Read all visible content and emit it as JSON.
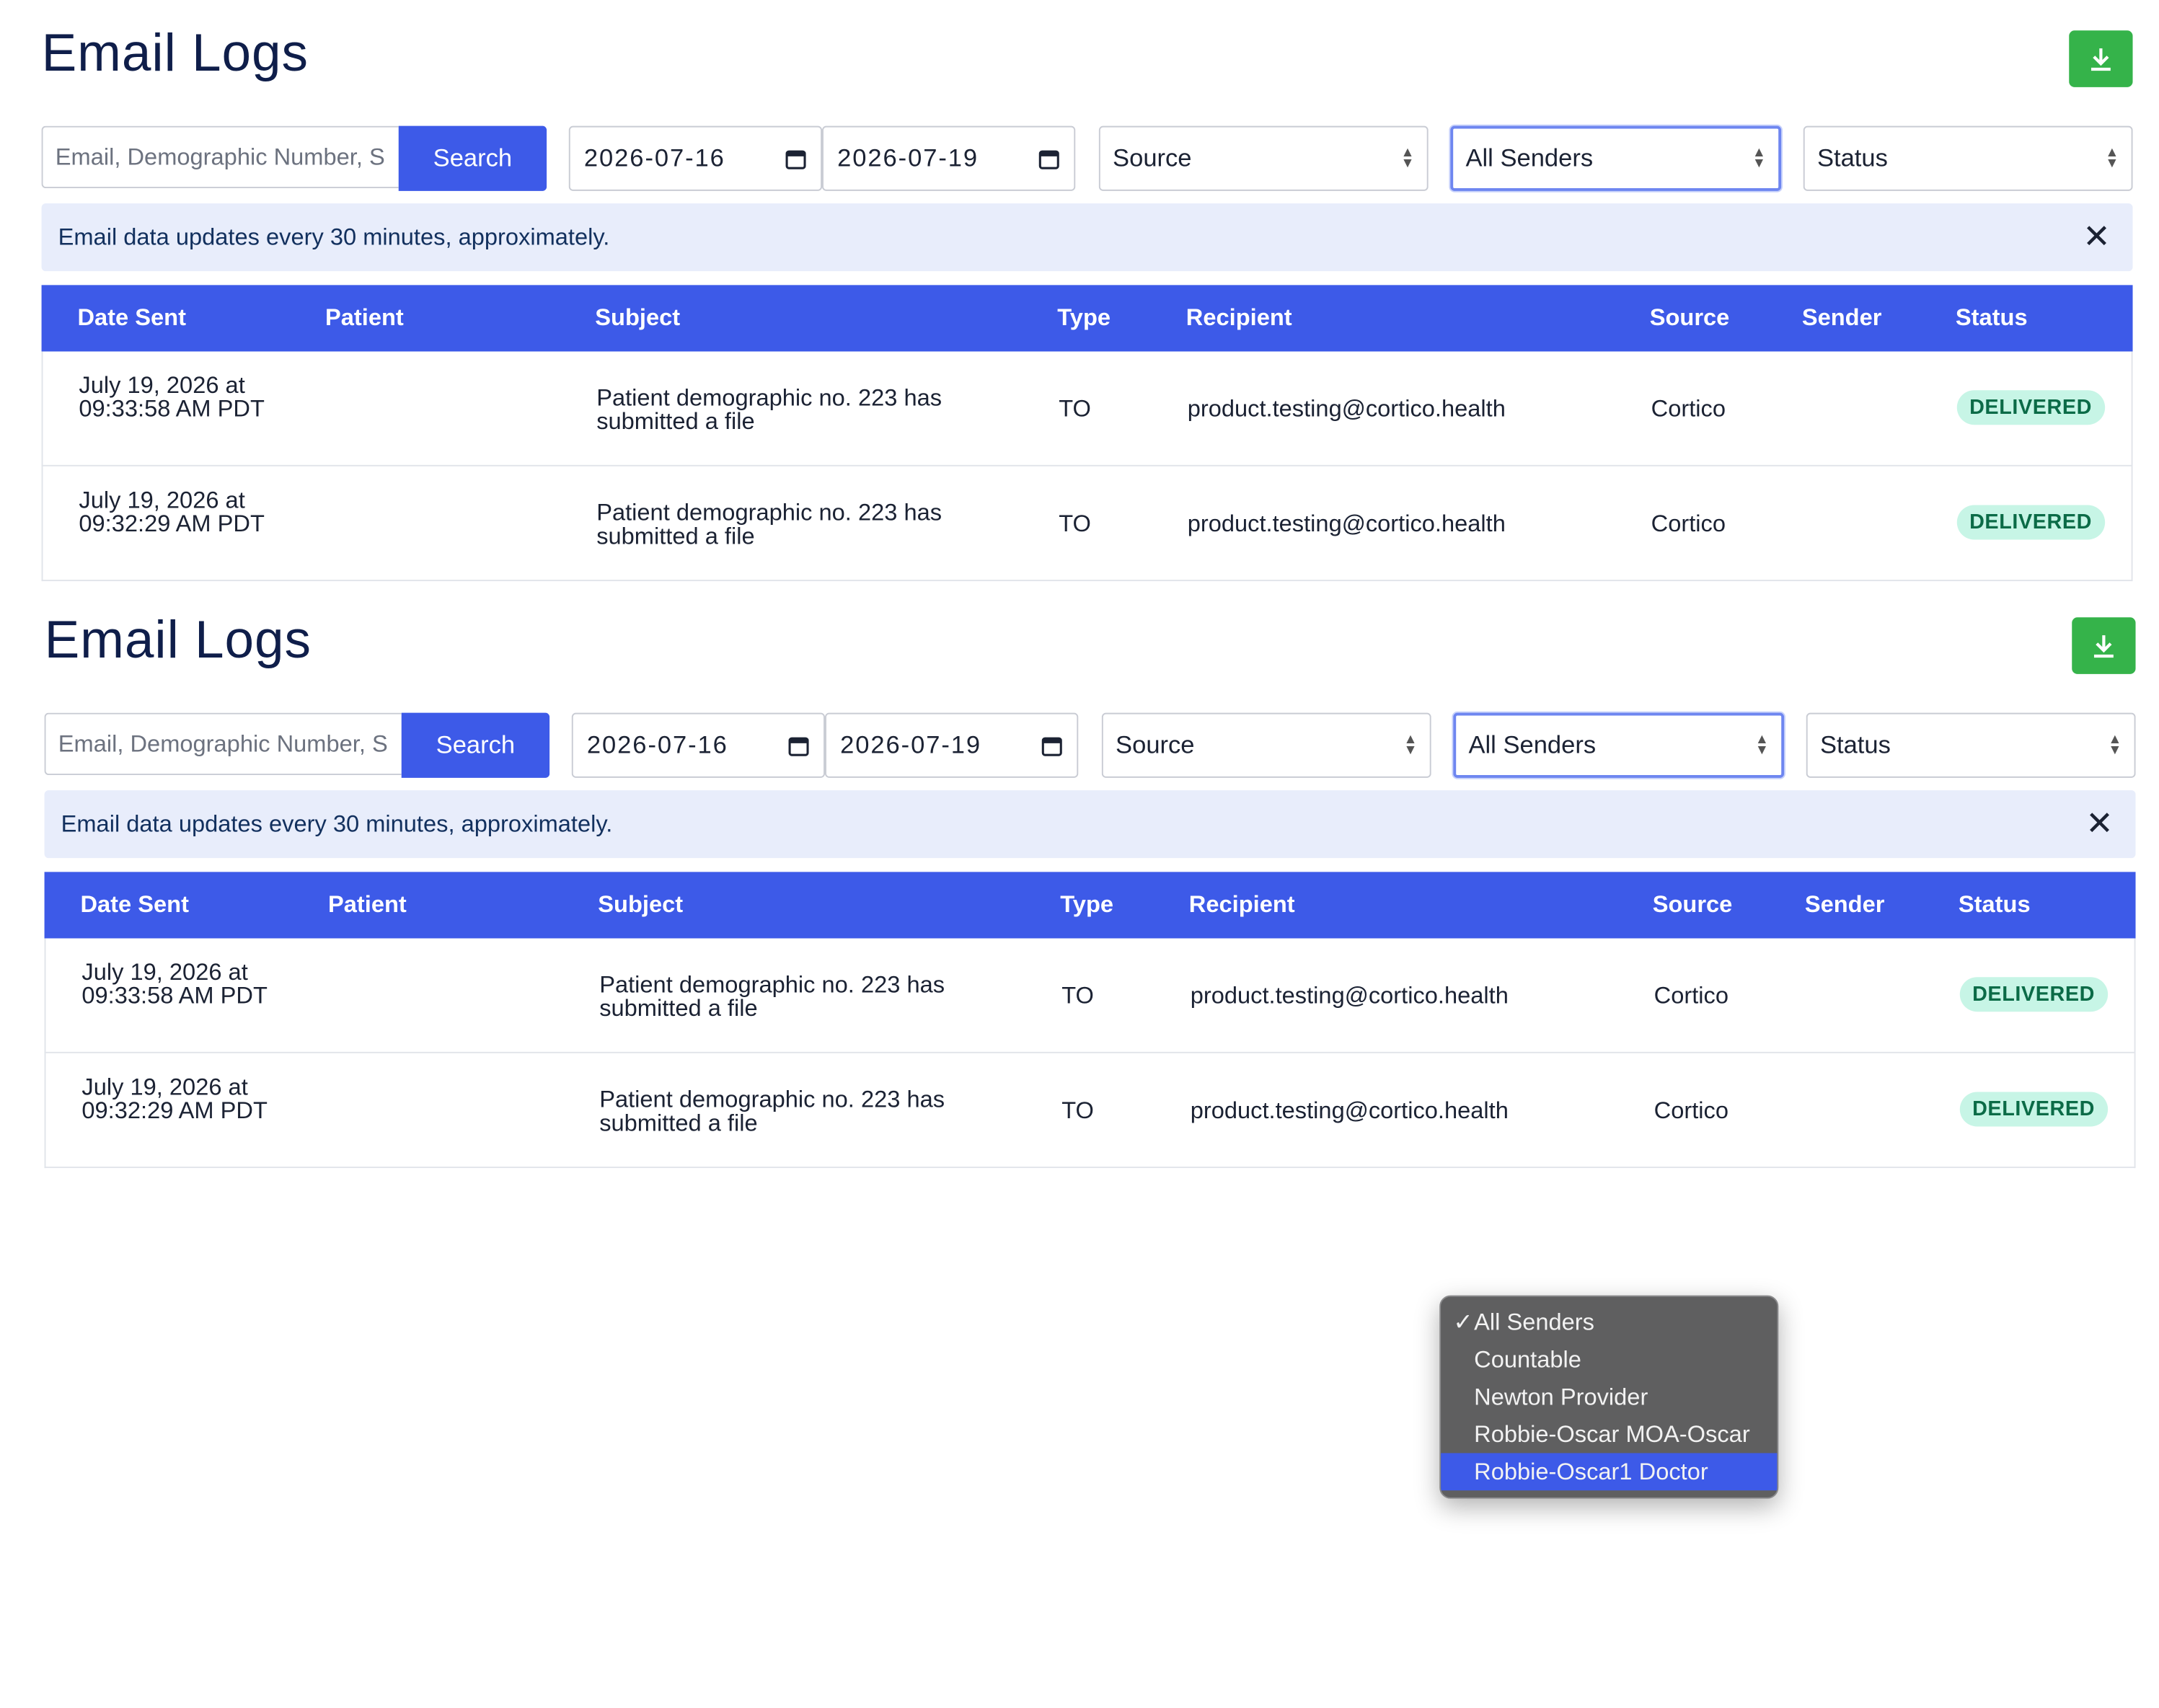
{
  "page": {
    "title": "Email Logs",
    "download_icon": "download-icon"
  },
  "filters": {
    "search_placeholder": "Email, Demographic Number, Subject",
    "search_button": "Search",
    "date_from": "2026-07-16",
    "date_to": "2026-07-19",
    "source": "Source",
    "sender": "All Senders",
    "status": "Status"
  },
  "alert": {
    "text": "Email data updates every 30 minutes, approximately.",
    "close": "✕"
  },
  "table": {
    "headers": {
      "date_sent": "Date Sent",
      "patient": "Patient",
      "subject": "Subject",
      "type": "Type",
      "recipient": "Recipient",
      "source": "Source",
      "sender": "Sender",
      "status": "Status"
    },
    "rows": [
      {
        "date_sent": "July 19, 2026 at 09:33:58 AM PDT",
        "patient": "",
        "subject": "Patient demographic no. 223 has submitted a file",
        "type": "TO",
        "recipient": "product.testing@cortico.health",
        "source": "Cortico",
        "sender": "",
        "status": "DELIVERED"
      },
      {
        "date_sent": "July 19, 2026 at 09:32:29 AM PDT",
        "patient": "",
        "subject": "Patient demographic no. 223 has submitted a file",
        "type": "TO",
        "recipient": "product.testing@cortico.health",
        "source": "Cortico",
        "sender": "",
        "status": "DELIVERED"
      }
    ]
  },
  "sender_dropdown": {
    "check": "✓",
    "options": [
      "All Senders",
      "Countable",
      "Newton Provider",
      "Robbie-Oscar MOA-Oscar",
      "Robbie-Oscar1 Doctor"
    ],
    "selected": "All Senders",
    "highlighted": "Robbie-Oscar1 Doctor"
  },
  "colors": {
    "primary": "#3d5ae8",
    "download_green": "#35b34a",
    "alert_bg": "#e8edfb",
    "badge_bg": "#c7f5e6",
    "badge_text": "#0b6b47"
  }
}
